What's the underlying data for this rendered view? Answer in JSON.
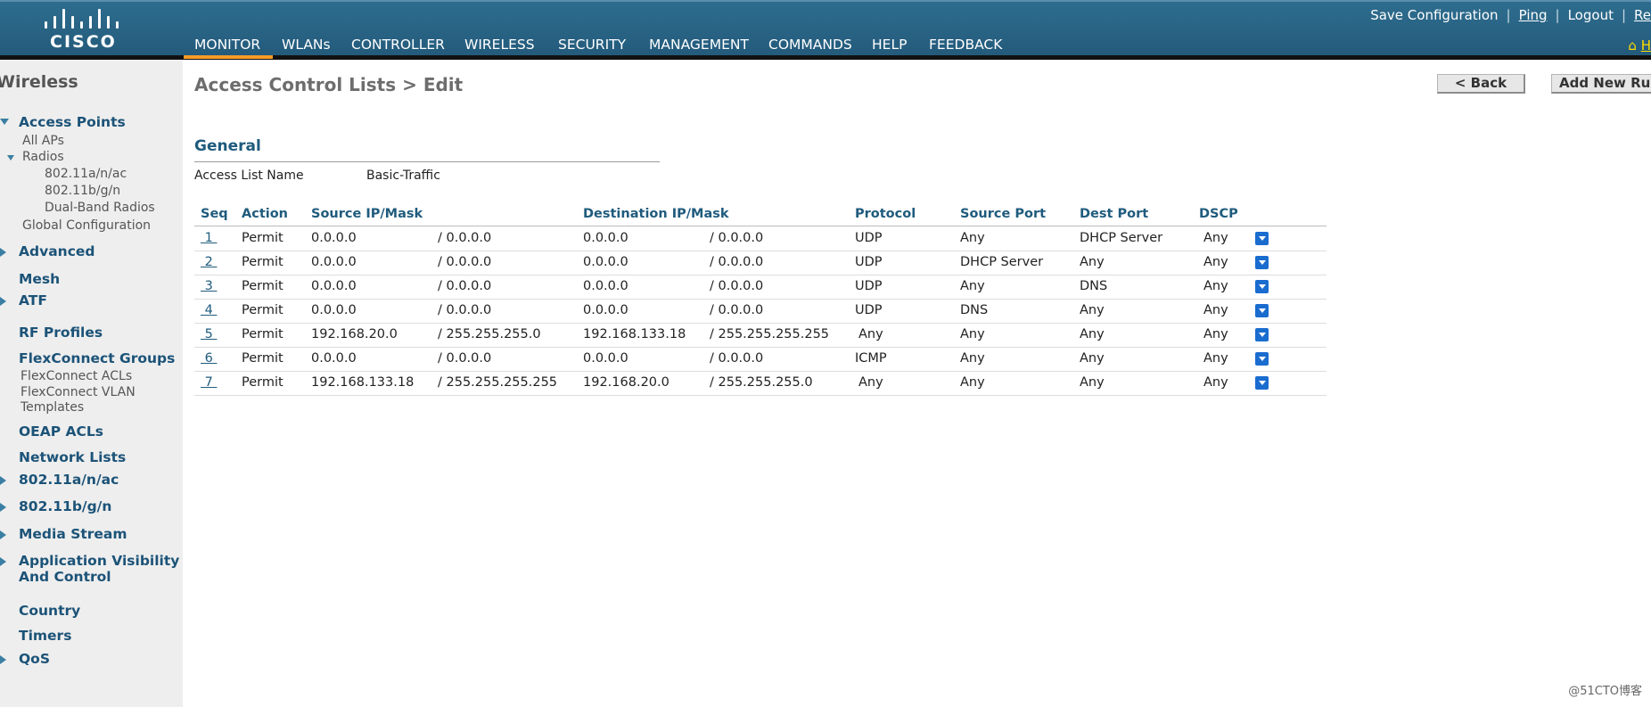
{
  "header": {
    "logo_text": "CISCO",
    "top_links": [
      "Save Configuration",
      "Ping",
      "Logout",
      "Re"
    ],
    "nav": [
      "MONITOR",
      "WLANs",
      "CONTROLLER",
      "WIRELESS",
      "SECURITY",
      "MANAGEMENT",
      "COMMANDS",
      "HELP",
      "FEEDBACK"
    ],
    "active_nav": "MONITOR",
    "home_label": "H"
  },
  "sidebar": {
    "title": "Wireless",
    "access_points": {
      "label": "Access Points",
      "all_aps": "All APs",
      "radios": "Radios",
      "radio_items": [
        "802.11a/n/ac",
        "802.11b/g/n",
        "Dual-Band Radios"
      ],
      "global_config": "Global Configuration"
    },
    "advanced": "Advanced",
    "mesh": "Mesh",
    "atf": "ATF",
    "rf_profiles": "RF Profiles",
    "flexconnect_groups": "FlexConnect Groups",
    "flexconnect_acls": "FlexConnect ACLs",
    "flexconnect_vlan_1": "FlexConnect VLAN",
    "flexconnect_vlan_2": "Templates",
    "oeap_acls": "OEAP ACLs",
    "network_lists": "Network Lists",
    "radio_a": "802.11a/n/ac",
    "radio_b": "802.11b/g/n",
    "media_stream": "Media Stream",
    "avc_1": "Application Visibility",
    "avc_2": "And Control",
    "country": "Country",
    "timers": "Timers",
    "qos": "QoS"
  },
  "main": {
    "title": "Access Control Lists > Edit",
    "back_button": "< Back",
    "add_rule_button": "Add New Rule",
    "general_heading": "General",
    "acl_name_label": "Access List Name",
    "acl_name_value": "Basic-Traffic",
    "columns": [
      "Seq",
      "Action",
      "Source IP/Mask",
      "Destination IP/Mask",
      "Protocol",
      "Source Port",
      "Dest Port",
      "DSCP"
    ],
    "rules": [
      {
        "seq": "1",
        "action": "Permit",
        "src_ip": "0.0.0.0",
        "src_mask": "/ 0.0.0.0",
        "dst_ip": "0.0.0.0",
        "dst_mask": "/ 0.0.0.0",
        "protocol": "UDP",
        "src_port": "Any",
        "dst_port": "DHCP Server",
        "dscp": "Any"
      },
      {
        "seq": "2",
        "action": "Permit",
        "src_ip": "0.0.0.0",
        "src_mask": "/ 0.0.0.0",
        "dst_ip": "0.0.0.0",
        "dst_mask": "/ 0.0.0.0",
        "protocol": "UDP",
        "src_port": "DHCP Server",
        "dst_port": "Any",
        "dscp": "Any"
      },
      {
        "seq": "3",
        "action": "Permit",
        "src_ip": "0.0.0.0",
        "src_mask": "/ 0.0.0.0",
        "dst_ip": "0.0.0.0",
        "dst_mask": "/ 0.0.0.0",
        "protocol": "UDP",
        "src_port": "Any",
        "dst_port": "DNS",
        "dscp": "Any"
      },
      {
        "seq": "4",
        "action": "Permit",
        "src_ip": "0.0.0.0",
        "src_mask": "/ 0.0.0.0",
        "dst_ip": "0.0.0.0",
        "dst_mask": "/ 0.0.0.0",
        "protocol": "UDP",
        "src_port": "DNS",
        "dst_port": "Any",
        "dscp": "Any"
      },
      {
        "seq": "5",
        "action": "Permit",
        "src_ip": "192.168.20.0",
        "src_mask": "/ 255.255.255.0",
        "dst_ip": "192.168.133.18",
        "dst_mask": "/ 255.255.255.255",
        "protocol": "Any",
        "src_port": "Any",
        "dst_port": "Any",
        "dscp": "Any"
      },
      {
        "seq": "6",
        "action": "Permit",
        "src_ip": "0.0.0.0",
        "src_mask": "/ 0.0.0.0",
        "dst_ip": "0.0.0.0",
        "dst_mask": "/ 0.0.0.0",
        "protocol": "ICMP",
        "src_port": "Any",
        "dst_port": "Any",
        "dscp": "Any"
      },
      {
        "seq": "7",
        "action": "Permit",
        "src_ip": "192.168.133.18",
        "src_mask": "/ 255.255.255.255",
        "dst_ip": "192.168.20.0",
        "dst_mask": "/ 255.255.255.0",
        "protocol": "Any",
        "src_port": "Any",
        "dst_port": "Any",
        "dscp": "Any"
      }
    ]
  },
  "watermark": "@51CTO博客",
  "colors": {
    "header": "#2a6688",
    "accent": "#f79c25",
    "link": "#1f5b7d",
    "dropdown": "#1a6ccf"
  }
}
